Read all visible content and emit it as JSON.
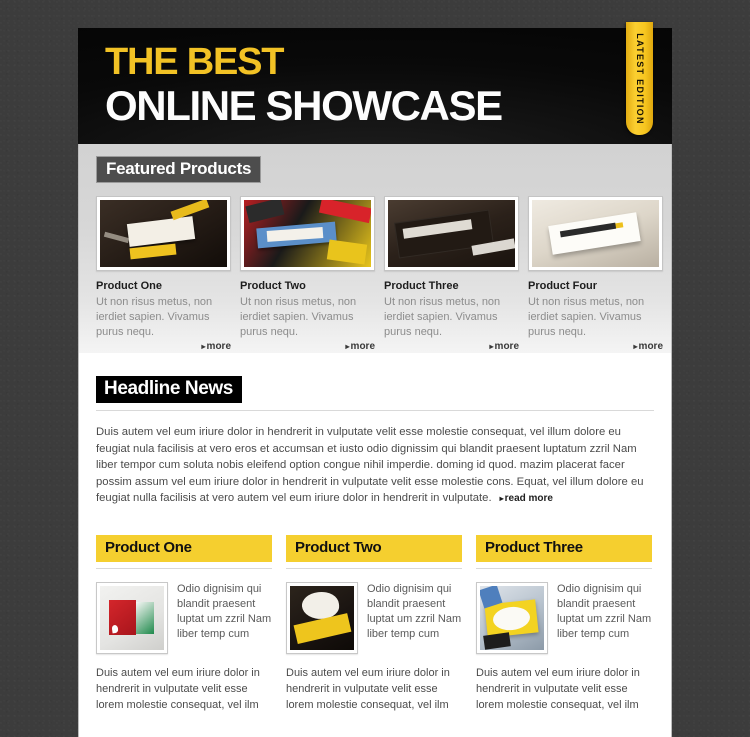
{
  "header": {
    "title_line1": "THE BEST",
    "title_line2": "ONLINE SHOWCASE",
    "ribbon_label": "LATEST EDITION"
  },
  "featured": {
    "heading": "Featured Products",
    "more_label": "more",
    "arrow": "▸",
    "products": [
      {
        "name": "Product One",
        "description": "Ut non risus metus, non ierdiet sapien. Vivamus purus nequ.",
        "art": "art-cards1"
      },
      {
        "name": "Product Two",
        "description": "Ut non risus metus, non ierdiet sapien. Vivamus purus nequ.",
        "art": "art-cards2"
      },
      {
        "name": "Product Three",
        "description": "Ut non risus metus, non ierdiet sapien. Vivamus purus nequ.",
        "art": "art-book"
      },
      {
        "name": "Product Four",
        "description": "Ut non risus metus, non ierdiet sapien. Vivamus purus nequ.",
        "art": "art-stack"
      }
    ]
  },
  "news": {
    "heading": "Headline News",
    "body": "Duis autem vel eum iriure dolor in hendrerit in vulputate velit esse molestie consequat, vel illum dolore eu feugiat nula facilisis at vero eros et accumsan et iusto odio dignissim qui blandit praesent luptatum zzril Nam liber tempor cum soluta nobis eleifend option congue nihil imperdie. doming id quod. mazim placerat facer possim assum vel eum iriure dolor in hendrerit in vulputate velit esse molestie cons. Equat, vel illum dolore eu feugiat nulla facilisis at vero autem vel eum iriure dolor in hendrerit in vulputate.",
    "read_more_label": "read more",
    "arrow": "▸"
  },
  "columns": [
    {
      "heading": "Product One",
      "snippet": "Odio dignisim qui blandit praesent luptat um zzril Nam liber temp cum",
      "body": "Duis autem vel eum iriure dolor in hendrerit in vulputate velit esse lorem molestie consequat, vel ilm",
      "art": "art-box"
    },
    {
      "heading": "Product Two",
      "snippet": "Odio dignisim qui blandit praesent luptat um zzril Nam liber temp cum",
      "body": "Duis autem vel eum iriure dolor in hendrerit in vulputate velit esse lorem molestie consequat, vel ilm",
      "art": "art-sticker"
    },
    {
      "heading": "Product Three",
      "snippet": "Odio dignisim qui blandit praesent luptat um zzril Nam liber temp cum",
      "body": "Duis autem vel eum iriure dolor in hendrerit in vulputate velit esse lorem molestie consequat, vel ilm",
      "art": "art-iprint"
    }
  ],
  "colors": {
    "page_background": "#3c3c3c",
    "banner_background": "#0b0b0b",
    "accent_gold": "#f2c225",
    "ribbon_gold": "#f7c61f",
    "column_heading_yellow": "#f5cf2f",
    "badge_dark": "#4d4d4d",
    "badge_black": "#000000"
  }
}
